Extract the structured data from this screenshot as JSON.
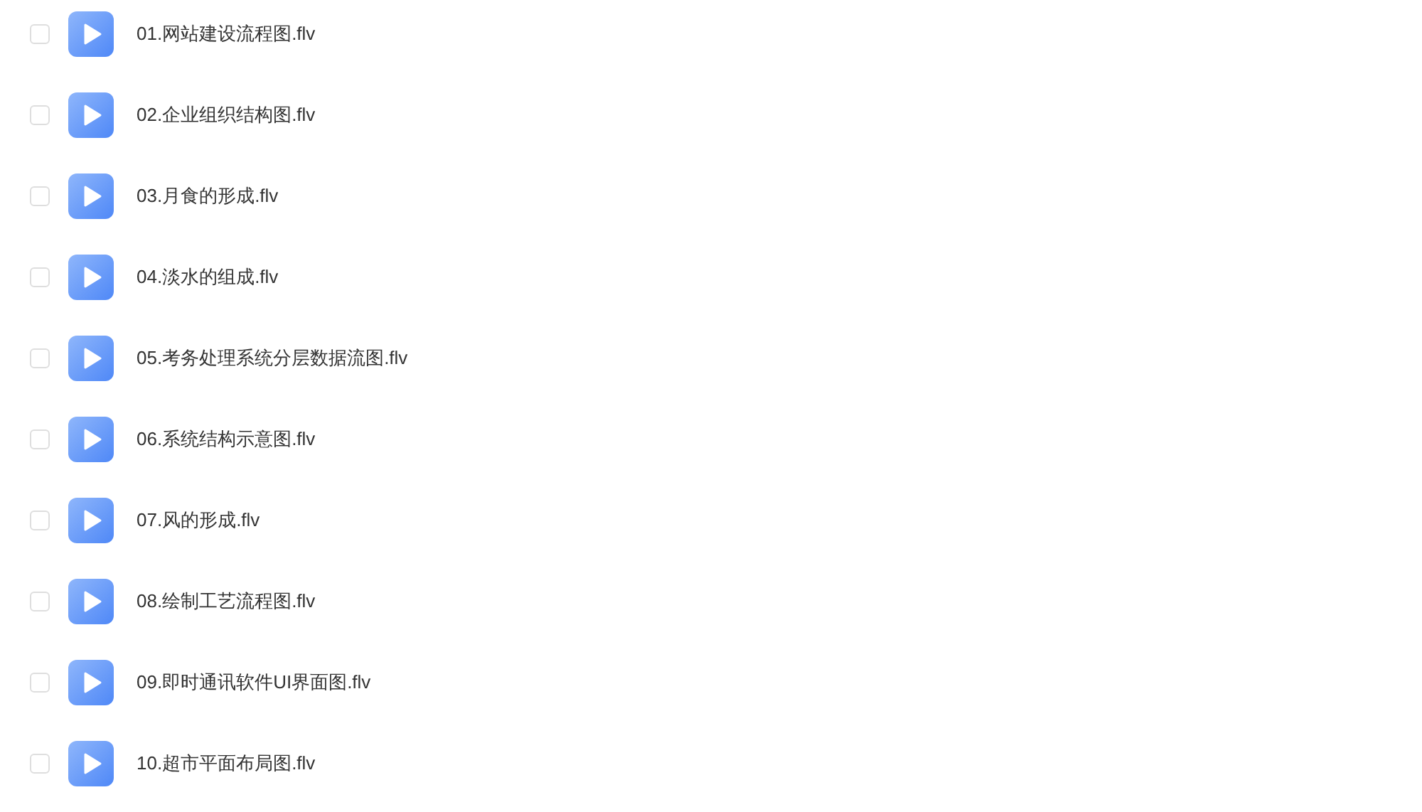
{
  "files": [
    {
      "name": "01.网站建设流程图.flv",
      "checked": false
    },
    {
      "name": "02.企业组织结构图.flv",
      "checked": false
    },
    {
      "name": "03.月食的形成.flv",
      "checked": false
    },
    {
      "name": "04.淡水的组成.flv",
      "checked": false
    },
    {
      "name": "05.考务处理系统分层数据流图.flv",
      "checked": false
    },
    {
      "name": "06.系统结构示意图.flv",
      "checked": false
    },
    {
      "name": "07.风的形成.flv",
      "checked": false
    },
    {
      "name": "08.绘制工艺流程图.flv",
      "checked": false
    },
    {
      "name": "09.即时通讯软件UI界面图.flv",
      "checked": false
    },
    {
      "name": "10.超市平面布局图.flv",
      "checked": false
    }
  ]
}
